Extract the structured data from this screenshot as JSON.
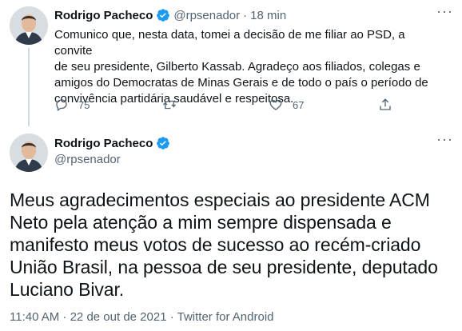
{
  "first_tweet": {
    "author_name": "Rodrigo Pacheco",
    "handle": "@rpsenador",
    "separator": "·",
    "time": "18 min",
    "more": "···",
    "text_lines": [
      "Comunico que, nesta data, tomei a decisão de me filiar ao PSD, a convite",
      "de seu presidente, Gilberto Kassab. Agradeço aos filiados, colegas e",
      "amigos do Democratas de Minas Gerais e de todo o país o período de",
      "convivência partidária saudável e respeitosa."
    ],
    "actions": {
      "reply_count": "75",
      "retweet_count": "",
      "like_count": "67"
    }
  },
  "main_tweet": {
    "author_name": "Rodrigo Pacheco",
    "handle": "@rpsenador",
    "more": "···",
    "text_lines": [
      "Meus agradecimentos especiais ao presidente ACM",
      "Neto pela atenção a mim sempre dispensada e",
      "manifesto meus votos de sucesso ao recém-criado",
      "União Brasil, na pessoa de seu presidente, deputado",
      "Luciano Bivar."
    ],
    "timestamp": "11:40 AM · 22 de out de 2021 · ",
    "source": "Twitter for Android"
  },
  "colors": {
    "verified_blue": "#1d9bf0",
    "muted": "#536471",
    "text": "#0f1419",
    "thread_line": "#cfd9de"
  },
  "icons": [
    "reply-icon",
    "retweet-icon",
    "like-icon",
    "share-icon",
    "verified-badge-icon"
  ]
}
